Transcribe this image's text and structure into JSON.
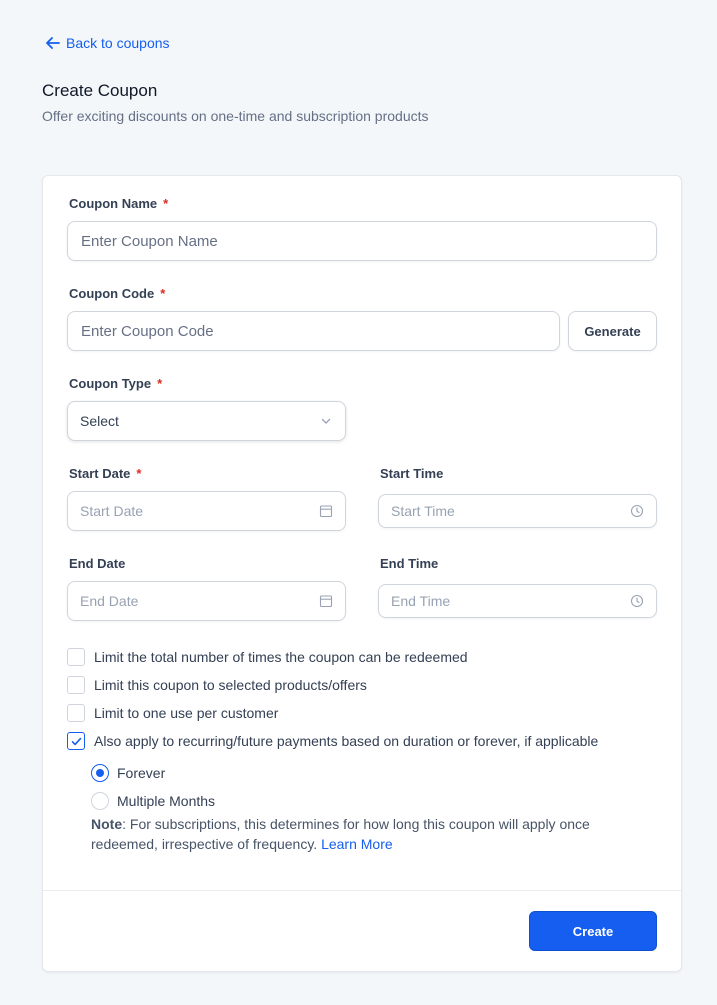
{
  "header": {
    "back_label": "Back to coupons",
    "title": "Create Coupon",
    "subtitle": "Offer exciting discounts on one-time and subscription products"
  },
  "form": {
    "coupon_name": {
      "label": "Coupon Name",
      "required": "*",
      "placeholder": "Enter Coupon Name"
    },
    "coupon_code": {
      "label": "Coupon Code",
      "required": "*",
      "placeholder": "Enter Coupon Code",
      "generate_label": "Generate"
    },
    "coupon_type": {
      "label": "Coupon Type",
      "required": "*",
      "value": "Select"
    },
    "start_date": {
      "label": "Start Date",
      "required": "*",
      "placeholder": "Start Date"
    },
    "start_time": {
      "label": "Start Time",
      "placeholder": "Start Time"
    },
    "end_date": {
      "label": "End Date",
      "placeholder": "End Date"
    },
    "end_time": {
      "label": "End Time",
      "placeholder": "End Time"
    },
    "options": [
      {
        "label": "Limit the total number of times the coupon can be redeemed",
        "checked": false
      },
      {
        "label": "Limit this coupon to selected products/offers",
        "checked": false
      },
      {
        "label": "Limit to one use per customer",
        "checked": false
      },
      {
        "label": "Also apply to recurring/future payments based on duration or forever, if applicable",
        "checked": true
      }
    ],
    "duration": [
      {
        "label": "Forever",
        "selected": true
      },
      {
        "label": "Multiple Months",
        "selected": false
      }
    ],
    "note": {
      "prefix": "Note",
      "text": ": For subscriptions, this determines for how long this coupon will apply once redeemed, irrespective of frequency. ",
      "link": "Learn More"
    },
    "create_label": "Create"
  },
  "icons": {
    "back": "arrow-left-icon",
    "select": "chevron-down-icon",
    "date": "calendar-icon",
    "time": "clock-icon",
    "check": "check-icon"
  },
  "colors": {
    "accent": "#155eef",
    "required": "#d92d20",
    "background": "#f3f7fa"
  }
}
